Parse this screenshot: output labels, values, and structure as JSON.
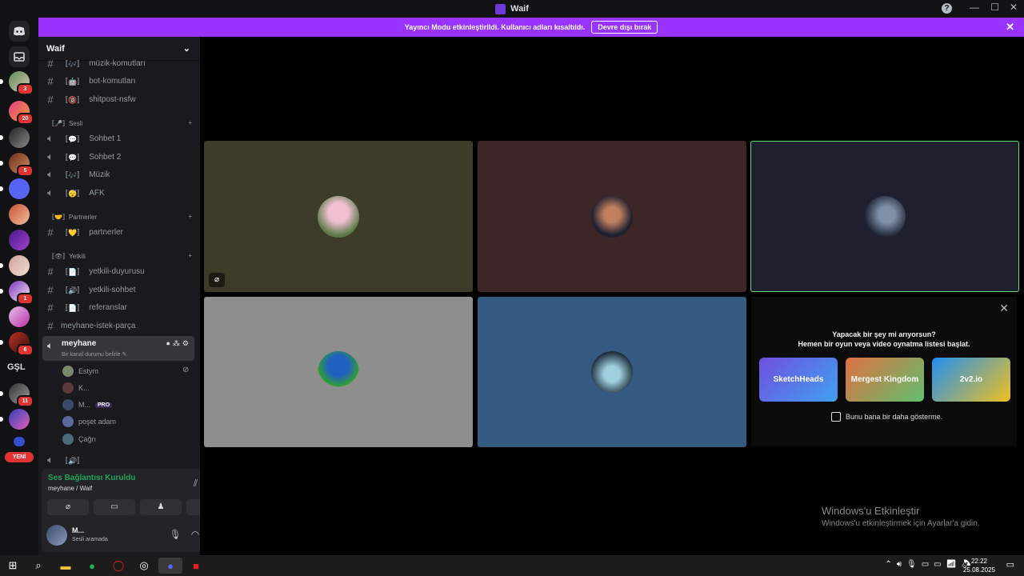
{
  "window": {
    "title": "Waif",
    "help": "?",
    "minimize": "—",
    "maximize": "☐",
    "close": "✕"
  },
  "banner": {
    "text": "Yayıncı Modu etkinleştirildi. Kullanıcı adları kısaltıldı.",
    "button": "Devre dışı bırak",
    "close": "✕"
  },
  "servers": {
    "badges": [
      "3",
      "20",
      "5",
      "1",
      "6",
      "11"
    ],
    "gsl": "GŞL",
    "new_label": "YENİ"
  },
  "guild": {
    "name": "Waif",
    "chevron": "⌄"
  },
  "channels": {
    "text_top": [
      {
        "name": "müzik-komutları",
        "emoji": "〚🎶〛"
      },
      {
        "name": "bot-komutları",
        "emoji": "〚🤖〛"
      },
      {
        "name": "shitpost-nsfw",
        "emoji": "〚🔞〛"
      }
    ],
    "cat_voice": "〚🎤〛Sesli",
    "voice": [
      {
        "name": "Sohbet 1",
        "emoji": "〚💬〛"
      },
      {
        "name": "Sohbet 2",
        "emoji": "〚💬〛"
      },
      {
        "name": "Müzik",
        "emoji": "〚🎶〛"
      },
      {
        "name": "AFK",
        "emoji": "〚😴〛"
      }
    ],
    "cat_partner": "〚🤝〛Partnerler",
    "partner": [
      {
        "name": "partnerler",
        "emoji": "〚💛〛"
      }
    ],
    "cat_staff": "〚👁〛Yetkili",
    "staff": [
      {
        "name": "yetkili-duyurusu",
        "emoji": "〚📄〛"
      },
      {
        "name": "yetkili-sohbet",
        "emoji": "〚🔊〛"
      },
      {
        "name": "referanslar",
        "emoji": "〚📄〛"
      }
    ],
    "request": "meyhane-istek-parça",
    "active": {
      "name": "meyhane",
      "status": "Bir kanal durumu belirle ✎"
    },
    "members": [
      {
        "name": "Estym"
      },
      {
        "name": "K..."
      },
      {
        "name": "M...",
        "badge": "PRO"
      },
      {
        "name": "poşet adam"
      },
      {
        "name": "Çağrı"
      }
    ],
    "bottom_voice": "〚🔊〛"
  },
  "voice_panel": {
    "status": "Ses Bağlantısı Kuruldu",
    "location": "meyhane / Waif"
  },
  "user_panel": {
    "name": "M...",
    "status": "Sesli aramada"
  },
  "promo": {
    "title": "Yapacak bir şey mi arıyorsun?",
    "subtitle": "Hemen bir oyun veya video oynatma listesi başlat.",
    "games": [
      "SketchHeads",
      "Mergest Kingdom",
      "2v2.io"
    ],
    "checkbox": "Bunu bana bir daha gösterme."
  },
  "activation": {
    "title": "Windows'u Etkinleştir",
    "subtitle": "Windows'u etkinleştirmek için Ayarlar'a gidin."
  },
  "taskbar": {
    "time": "22:22",
    "date": "25.08.2025"
  }
}
